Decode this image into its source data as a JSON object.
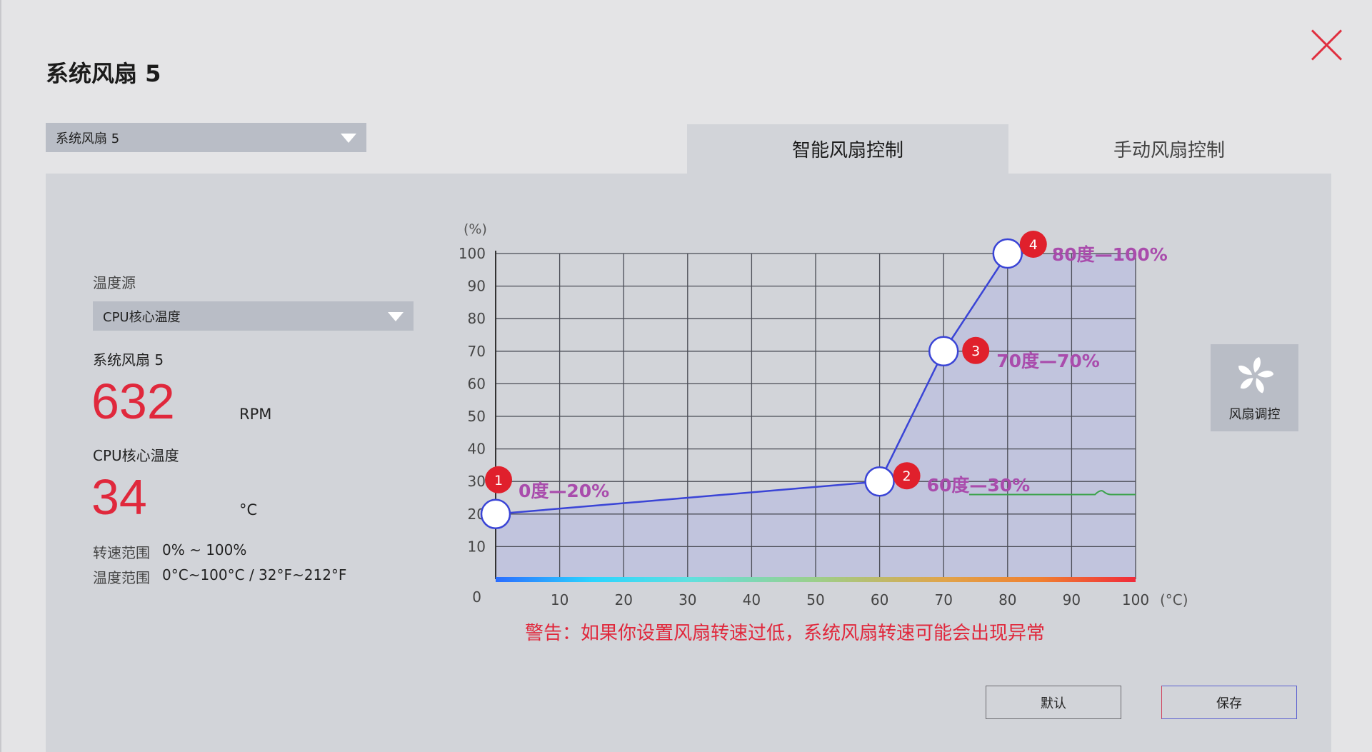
{
  "title": "系统风扇 5",
  "fan_select": {
    "value": "系统风扇 5"
  },
  "tabs": [
    {
      "label": "智能风扇控制",
      "active": true
    },
    {
      "label": "手动风扇控制",
      "active": false
    }
  ],
  "left": {
    "temp_source_label": "温度源",
    "temp_source_value": "CPU核心温度",
    "fan_name": "系统风扇 5",
    "rpm_value": "632",
    "rpm_unit": "RPM",
    "temp_name": "CPU核心温度",
    "temp_value": "34",
    "temp_unit": "°C",
    "speed_range_label": "转速范围",
    "speed_range_value": "0% ~ 100%",
    "temp_range_label": "温度范围",
    "temp_range_value": "0°C~100°C / 32°F~212°F"
  },
  "chart_data": {
    "type": "line",
    "y_unit": "(%)",
    "x_unit": "(°C)",
    "origin_label": "0",
    "xlim": [
      0,
      100
    ],
    "ylim": [
      0,
      100
    ],
    "x_ticks": [
      "10",
      "20",
      "30",
      "40",
      "50",
      "60",
      "70",
      "80",
      "90",
      "100"
    ],
    "y_ticks": [
      "10",
      "20",
      "30",
      "40",
      "50",
      "60",
      "70",
      "80",
      "90",
      "100"
    ],
    "grid": true,
    "points": [
      {
        "n": "1",
        "x": 0,
        "y": 20,
        "label": "0度—20%"
      },
      {
        "n": "2",
        "x": 60,
        "y": 30,
        "label": "60度—30%"
      },
      {
        "n": "3",
        "x": 70,
        "y": 70,
        "label": "70度—70%"
      },
      {
        "n": "4",
        "x": 80,
        "y": 100,
        "label": "80度—100%"
      }
    ],
    "current_level_x_start": 74,
    "current_level_y": 26,
    "colors": {
      "curve": "#3a44d6",
      "fill": "#b3b6e0",
      "label": "#a94cac",
      "badge": "#e0202c",
      "current_level": "#3aa24a"
    }
  },
  "warning": "警告：如果你设置风扇转速过低，系统风扇转速可能会出现异常",
  "fan_tuning": {
    "label": "风扇调控",
    "icon": "fan-icon"
  },
  "buttons": {
    "default": "默认",
    "save": "保存"
  }
}
